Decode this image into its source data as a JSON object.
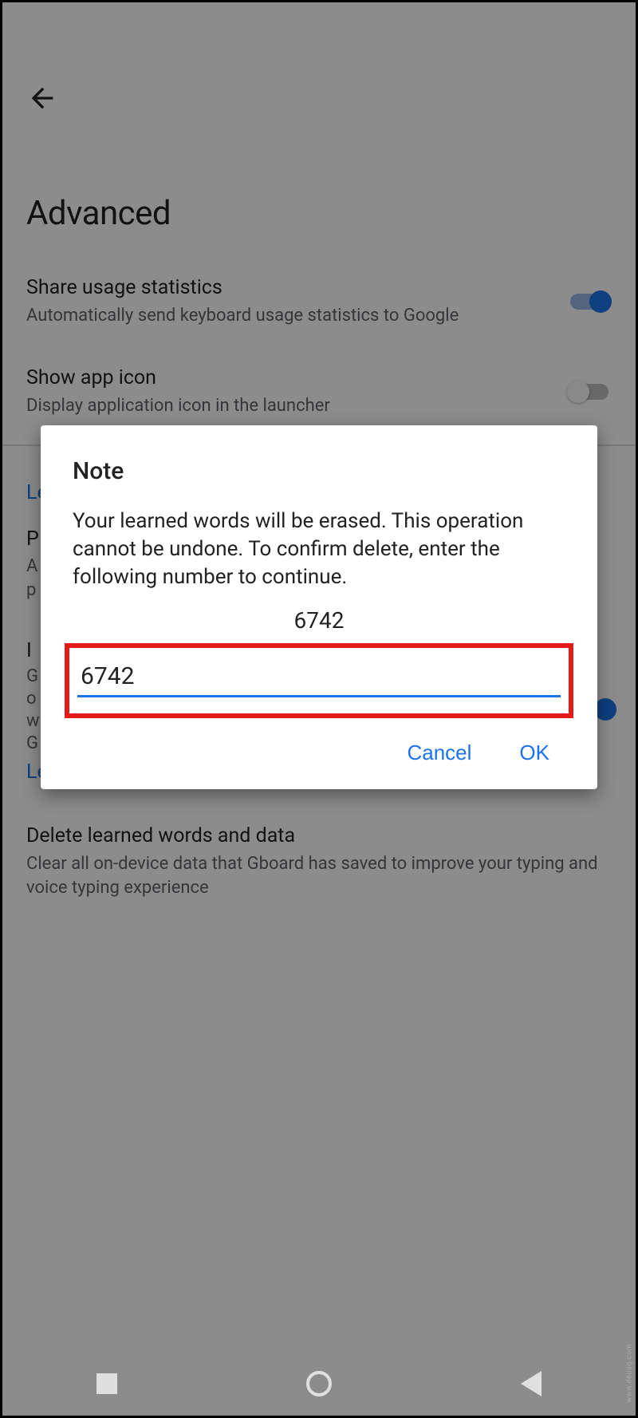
{
  "header": {
    "title": "Advanced"
  },
  "settings": {
    "share_stats": {
      "title": "Share usage statistics",
      "subtitle": "Automatically send keyboard usage statistics to Google",
      "on": true
    },
    "show_icon": {
      "title": "Show app icon",
      "subtitle": "Display application icon in the launcher",
      "on": false
    },
    "delete_words": {
      "title": "Delete learned words and data",
      "subtitle": "Clear all on-device data that Gboard has saved to improve your typing and voice typing experience"
    }
  },
  "partial": {
    "learn_more_1": "Le",
    "p_title_prefix": "P",
    "p_sub1": "A",
    "p_sub2": "p",
    "i_title_prefix": "I",
    "g_line1": "G",
    "g_line2": "o",
    "g_line3": "w",
    "g_line4": "G",
    "learn_more_2": "Le"
  },
  "dialog": {
    "title": "Note",
    "body": "Your learned words will be erased. This operation cannot be undone. To confirm delete, enter the following number to continue.",
    "confirm_number": "6742",
    "input_value": "6742",
    "cancel": "Cancel",
    "ok": "OK"
  },
  "watermark": "www.deuaq.com"
}
